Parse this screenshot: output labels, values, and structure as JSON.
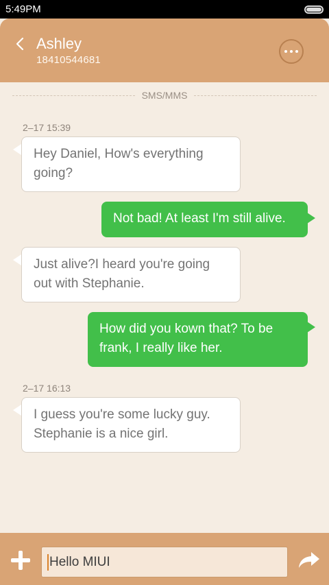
{
  "status_bar": {
    "time": "5:49PM"
  },
  "header": {
    "contact_name": "Ashley",
    "contact_number": "18410544681"
  },
  "divider_label": "SMS/MMS",
  "timestamps": [
    "2–17 15:39",
    "2–17 16:13"
  ],
  "messages": [
    {
      "direction": "incoming",
      "line1": "Hey Daniel, How's everything",
      "line2": "going?"
    },
    {
      "direction": "outgoing",
      "line1": "Not bad! At least I'm still alive."
    },
    {
      "direction": "incoming",
      "line1": "Just  alive?I heard you're going",
      "line2": "out with Stephanie."
    },
    {
      "direction": "outgoing",
      "line1": "How did you kown that? To be",
      "line2": "frank, I really like her."
    },
    {
      "direction": "incoming",
      "line1": "I guess you're some lucky guy.",
      "line2": "Stephanie is a nice girl."
    }
  ],
  "composer": {
    "text": "Hello MIUI"
  },
  "colors": {
    "header_bg": "#d9a475",
    "chat_bg": "#f5ede3",
    "outgoing_bubble": "#42bf4a",
    "incoming_bubble": "#ffffff"
  },
  "icons": [
    "back-arrow-icon",
    "more-icon",
    "plus-icon",
    "send-icon",
    "battery-icon"
  ]
}
